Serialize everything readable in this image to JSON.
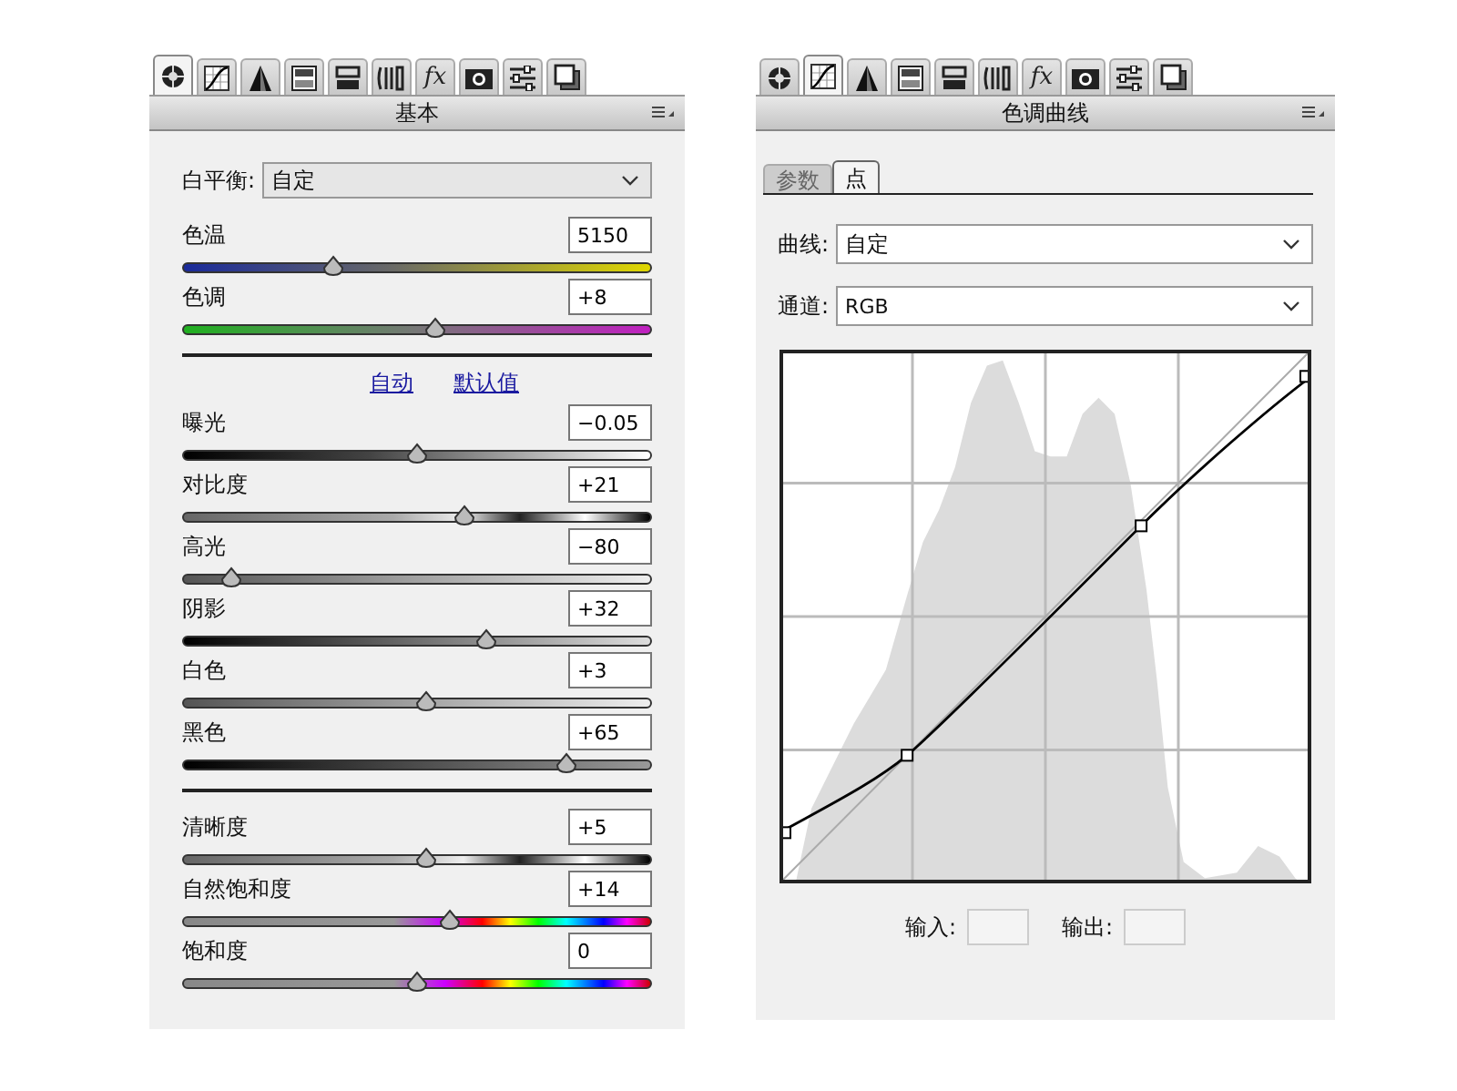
{
  "left_panel": {
    "tool_tabs": [
      {
        "kind": "aperture",
        "selected": true
      },
      {
        "kind": "curve",
        "selected": false
      },
      {
        "kind": "triangle",
        "selected": false
      },
      {
        "kind": "gradient-bars",
        "selected": false
      },
      {
        "kind": "bars",
        "selected": false
      },
      {
        "kind": "lens",
        "selected": false
      },
      {
        "kind": "fx",
        "glyph": "fx",
        "selected": false
      },
      {
        "kind": "camera",
        "selected": false
      },
      {
        "kind": "sliders",
        "selected": false
      },
      {
        "kind": "layers",
        "selected": false
      }
    ],
    "title": "基本",
    "white_balance": {
      "label": "白平衡:",
      "value": "自定"
    },
    "sliders_top": [
      {
        "label": "色温",
        "value": "5150",
        "level": 0.32,
        "kind": "temperature"
      },
      {
        "label": "色调",
        "value": "+8",
        "level": 0.54,
        "kind": "tint"
      }
    ],
    "links": [
      "自动",
      "默认值"
    ],
    "sliders_tone": [
      {
        "label": "曝光",
        "value": "−0.05",
        "level": 0.5,
        "kind": "exposure"
      },
      {
        "label": "对比度",
        "value": "+21",
        "level": 0.6,
        "kind": "contrast"
      },
      {
        "label": "高光",
        "value": "−80",
        "level": 0.1,
        "kind": "highlights"
      },
      {
        "label": "阴影",
        "value": "+32",
        "level": 0.65,
        "kind": "shadows"
      },
      {
        "label": "白色",
        "value": "+3",
        "level": 0.52,
        "kind": "whites"
      },
      {
        "label": "黑色",
        "value": "+65",
        "level": 0.82,
        "kind": "blacks"
      }
    ],
    "sliders_presence": [
      {
        "label": "清晰度",
        "value": "+5",
        "level": 0.52,
        "kind": "clarity"
      },
      {
        "label": "自然饱和度",
        "value": "+14",
        "level": 0.57,
        "kind": "vibrance"
      },
      {
        "label": "饱和度",
        "value": "0",
        "level": 0.5,
        "kind": "saturation"
      }
    ]
  },
  "right_panel": {
    "tool_tabs": [
      {
        "kind": "aperture",
        "selected": false
      },
      {
        "kind": "curve",
        "selected": true
      },
      {
        "kind": "triangle",
        "selected": false
      },
      {
        "kind": "gradient-bars",
        "selected": false
      },
      {
        "kind": "bars",
        "selected": false
      },
      {
        "kind": "lens",
        "selected": false
      },
      {
        "kind": "fx",
        "glyph": "fx",
        "selected": false
      },
      {
        "kind": "camera",
        "selected": false
      },
      {
        "kind": "sliders",
        "selected": false
      },
      {
        "kind": "layers",
        "selected": false
      }
    ],
    "title": "色调曲线",
    "sub_tabs": [
      {
        "label": "参数",
        "selected": false
      },
      {
        "label": "点",
        "selected": true
      }
    ],
    "curve": {
      "label": "曲线:",
      "value": "自定"
    },
    "channel": {
      "label": "通道:",
      "value": "RGB"
    },
    "input_label": "输入:",
    "output_label": "输出:"
  }
}
